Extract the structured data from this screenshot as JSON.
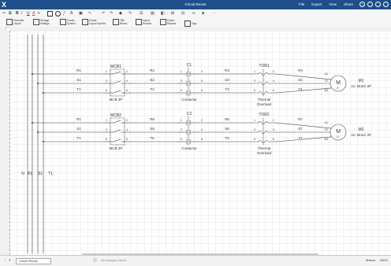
{
  "titlebar": {
    "app_icon": "X",
    "title": "Circuit Reuse",
    "menus": [
      "File",
      "Export",
      "View",
      "Share"
    ]
  },
  "toolbar2": [
    {
      "label": "Generate\nLayout"
    },
    {
      "label": "Storage\nSettings"
    },
    {
      "label": "Create\nSymbol"
    },
    {
      "label": "Create\nLayout Symbol"
    },
    {
      "label": "Title\nBlocks"
    },
    {
      "label": "Import\nReports"
    },
    {
      "label": "Export\nReports"
    },
    {
      "label": "Tags"
    }
  ],
  "diagram": {
    "buses": [
      "N",
      "R1",
      "S1",
      "T1"
    ],
    "groups": [
      {
        "mcb": {
          "name": "MCB1",
          "type": "MCB 3P",
          "left_pins": [
            "1",
            "3",
            "5"
          ],
          "right_pins": [
            "2",
            "4",
            "6"
          ]
        },
        "wires_in": [
          "R1",
          "S1",
          "T1"
        ],
        "wires_mid": [
          "R2",
          "S2",
          "T2"
        ],
        "contactor": {
          "name": "C1",
          "type": "Contactor",
          "left_pins": [
            "1",
            "3",
            "5"
          ],
          "right_pins": [
            "2",
            "4",
            "6"
          ]
        },
        "wires_c": [
          "R3",
          "S3",
          "T3"
        ],
        "overload": {
          "name": "TOR1",
          "type": "Thermal\nOverload",
          "left_pins": [
            "1",
            "3",
            "5"
          ],
          "right_pins": [
            "2",
            "4",
            "6"
          ]
        },
        "wires_out": [
          "R4",
          "S4",
          "T4"
        ],
        "motor_pins": [
          "U1",
          "V1",
          "W1"
        ],
        "motor": {
          "name": "M1",
          "type": "AC Motor 3P",
          "symbol": "M",
          "sub": "3~"
        }
      },
      {
        "mcb": {
          "name": "MCB2",
          "type": "MCB 3P",
          "left_pins": [
            "1",
            "3",
            "5"
          ],
          "right_pins": [
            "2",
            "4",
            "6"
          ]
        },
        "wires_in": [
          "R1",
          "S1",
          "T1"
        ],
        "wires_mid": [
          "R5",
          "S5",
          "T5"
        ],
        "contactor": {
          "name": "C2",
          "type": "Contactor",
          "left_pins": [
            "1",
            "3",
            "5"
          ],
          "right_pins": [
            "2",
            "4",
            "6"
          ]
        },
        "wires_c": [
          "R6",
          "S6",
          "T6"
        ],
        "overload": {
          "name": "TOR2",
          "type": "Thermal\nOverload",
          "left_pins": [
            "1",
            "3",
            "5"
          ],
          "right_pins": [
            "2",
            "4",
            "6"
          ]
        },
        "wires_out": [
          "R7",
          "S7",
          "T7"
        ],
        "motor_pins": [
          "U1",
          "V1",
          "W1"
        ],
        "motor": {
          "name": "M2",
          "type": "AC Motor 3P",
          "symbol": "M",
          "sub": "3~"
        }
      }
    ]
  },
  "statusbar": {
    "page": "Circuit Reuse",
    "saved": "All changes saved",
    "mode": "Videos",
    "zoom": "100%"
  }
}
